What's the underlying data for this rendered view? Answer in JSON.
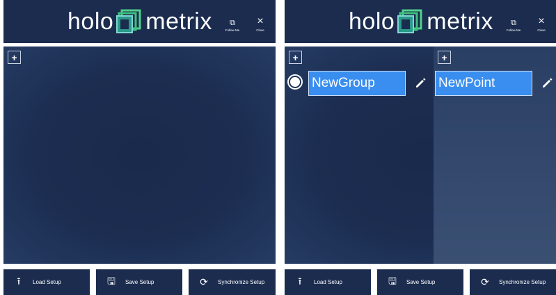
{
  "colors": {
    "header_bg": "#1b2c4f",
    "accent": "#3a8ef0",
    "logo_green": "#3fbf7f"
  },
  "logo": {
    "left": "holo",
    "right": "metrix"
  },
  "header": {
    "follow_me_label": "Follow Me",
    "follow_me_icon": "pin-window-icon",
    "close_label": "Close",
    "close_icon": "×"
  },
  "workspace": {
    "add_group_symbol": "+",
    "add_point_symbol": "+",
    "group_name": "NewGroup",
    "point_name": "NewPoint"
  },
  "toolbar": {
    "load_label": "Load Setup",
    "save_label": "Save Setup",
    "sync_label": "Synchronize Setup",
    "load_icon": "⭱",
    "save_icon": "🖫",
    "sync_icon": "⟳"
  }
}
